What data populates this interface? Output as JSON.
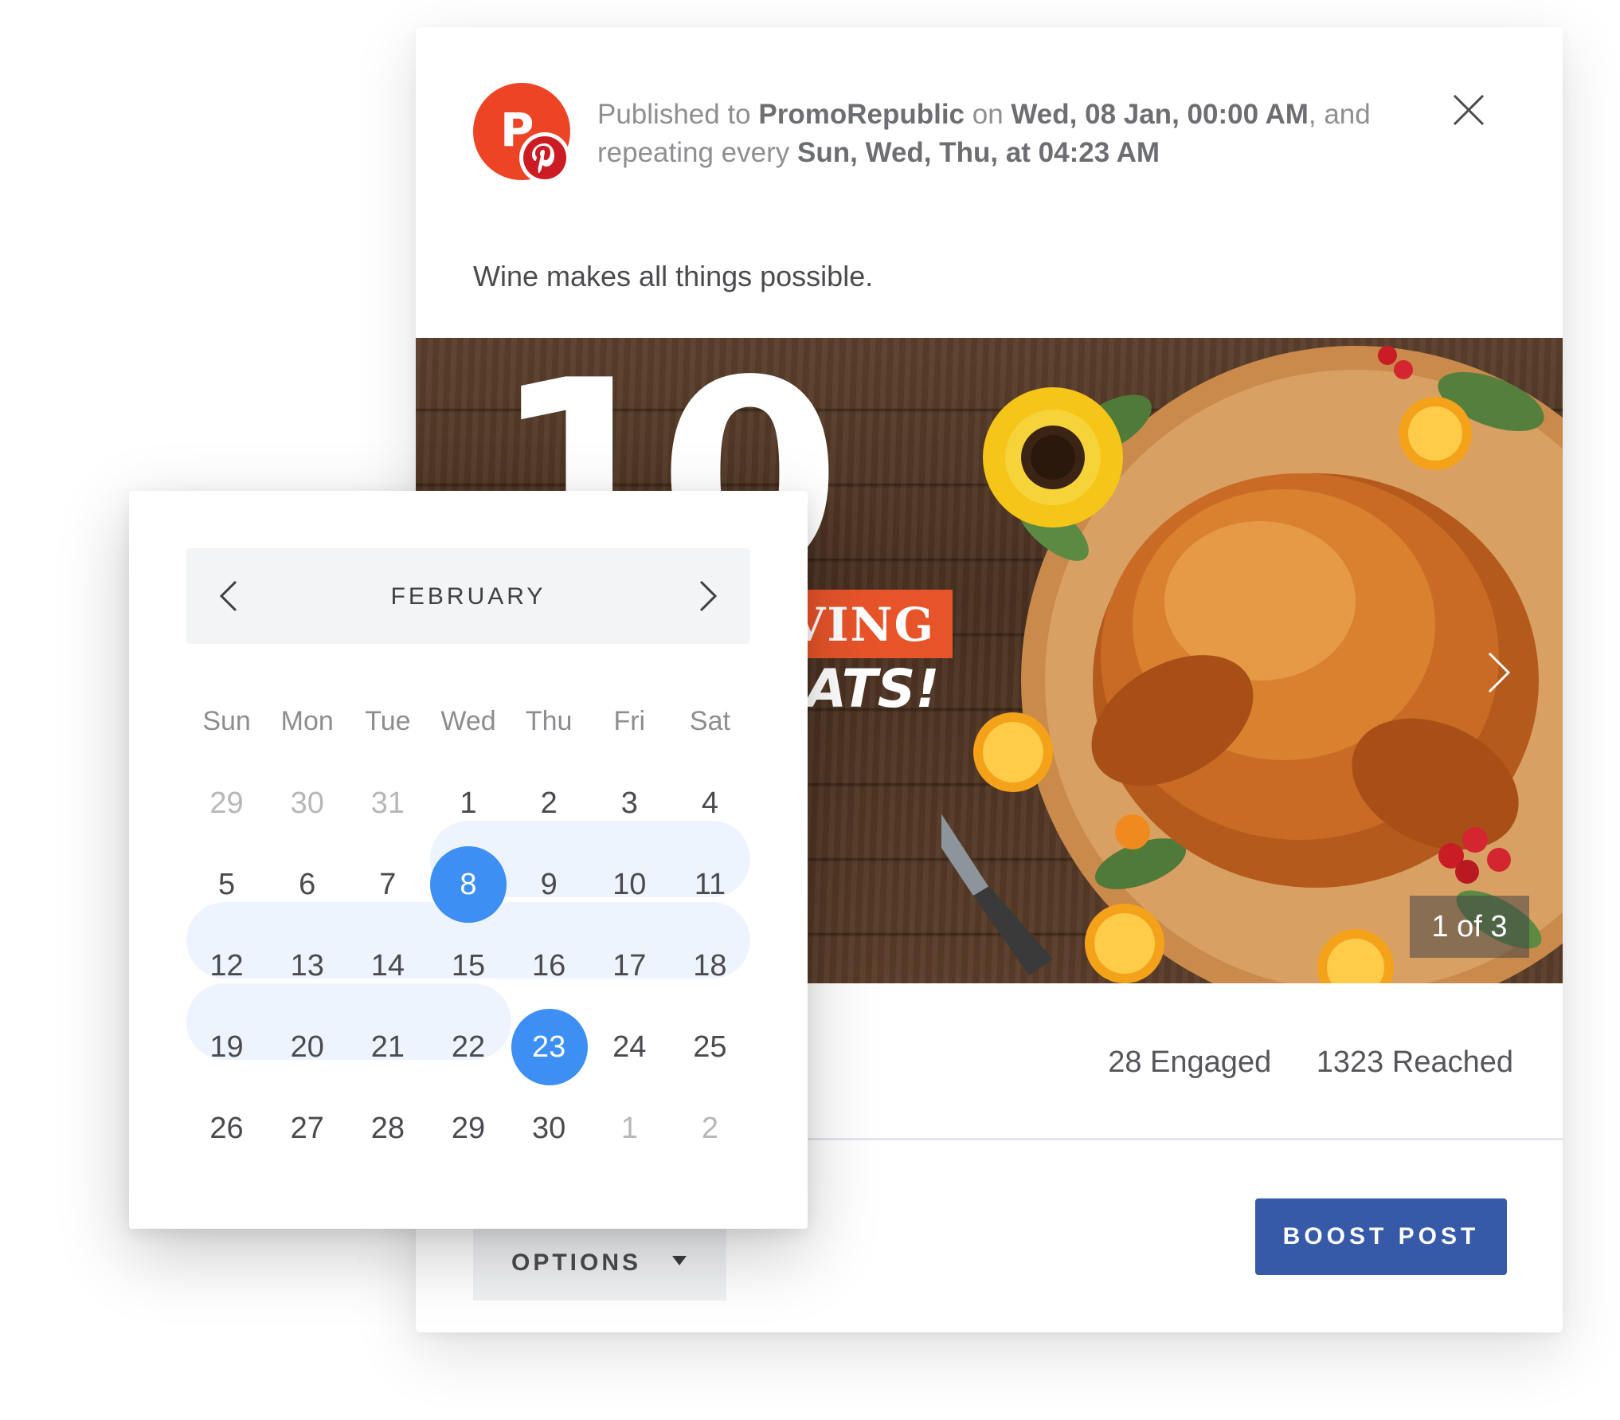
{
  "header": {
    "prefix": "Published to ",
    "account": "PromoRepublic",
    "on_word": " on ",
    "date": "Wed, 08 Jan, 00:00 AM",
    "and_word": ", and",
    "repeat_prefix": "repeating every ",
    "repeat_value": "Sun, Wed, Thu, at 04:23 AM",
    "avatar_letter": "P"
  },
  "post": {
    "text": "Wine makes all things possible.",
    "image": {
      "big_number": "10",
      "orange_text": "VING",
      "white_text": "ATS!",
      "slide_counter": "1 of 3"
    }
  },
  "stats": {
    "engaged": "28 Engaged",
    "reached": "1323 Reached"
  },
  "actions": {
    "options_label": "OPTIONS",
    "boost_label": "BOOST POST"
  },
  "calendar": {
    "month": "FEBRUARY",
    "weekdays": [
      "Sun",
      "Mon",
      "Tue",
      "Wed",
      "Thu",
      "Fri",
      "Sat"
    ],
    "weeks": [
      [
        {
          "d": "29",
          "m": true
        },
        {
          "d": "30",
          "m": true
        },
        {
          "d": "31",
          "m": true
        },
        {
          "d": "1"
        },
        {
          "d": "2"
        },
        {
          "d": "3"
        },
        {
          "d": "4"
        }
      ],
      [
        {
          "d": "5"
        },
        {
          "d": "6"
        },
        {
          "d": "7"
        },
        {
          "d": "8",
          "sel": true
        },
        {
          "d": "9"
        },
        {
          "d": "10"
        },
        {
          "d": "11"
        }
      ],
      [
        {
          "d": "12"
        },
        {
          "d": "13"
        },
        {
          "d": "14"
        },
        {
          "d": "15"
        },
        {
          "d": "16"
        },
        {
          "d": "17"
        },
        {
          "d": "18"
        }
      ],
      [
        {
          "d": "19"
        },
        {
          "d": "20"
        },
        {
          "d": "21"
        },
        {
          "d": "22"
        },
        {
          "d": "23",
          "sel": true
        },
        {
          "d": "24"
        },
        {
          "d": "25"
        }
      ],
      [
        {
          "d": "26"
        },
        {
          "d": "27"
        },
        {
          "d": "28"
        },
        {
          "d": "29"
        },
        {
          "d": "30"
        },
        {
          "d": "1",
          "m": true
        },
        {
          "d": "2",
          "m": true
        }
      ]
    ],
    "range_start": "8",
    "range_end": "23"
  },
  "colors": {
    "accent_blue": "#3d8ff3",
    "range_fill": "#eef4fd",
    "boost_button": "#3659a8",
    "brand_red": "#ec4424",
    "pinterest_red": "#cb1c24"
  },
  "icons": {
    "close": "close-icon",
    "prev": "chevron-left-icon",
    "next": "chevron-right-icon",
    "slide_next": "chevron-right-icon",
    "options_caret": "caret-down-icon",
    "pinterest": "pinterest-icon"
  }
}
